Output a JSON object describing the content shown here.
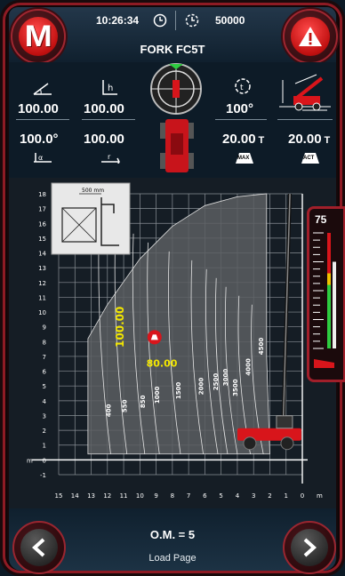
{
  "header": {
    "time": "10:26:34",
    "hours": "50000",
    "model": "FORK FC5T"
  },
  "params": {
    "row1_left_a": "100.00",
    "row1_left_b": "100.00",
    "row1_right": "100",
    "row1_right_unit": "°",
    "row2_left_a": "100.0°",
    "row2_left_b": "100.00",
    "row2_right_a": "20.00",
    "row2_right_a_unit": "T",
    "row2_right_b": "20.00",
    "row2_right_b_unit": "T",
    "max_label": "MAX",
    "act_label": "ACT"
  },
  "chart": {
    "inset_label": "500 mm",
    "boom_angle_value": "100.00",
    "load_value": "80.00",
    "y_unit": "m",
    "x_unit": "m",
    "y_ticks": [
      "18",
      "17",
      "16",
      "15",
      "14",
      "13",
      "12",
      "11",
      "10",
      "9",
      "8",
      "7",
      "6",
      "5",
      "4",
      "3",
      "2",
      "1",
      "0",
      "-1"
    ],
    "x_ticks": [
      "15",
      "14",
      "13",
      "12",
      "11",
      "10",
      "9",
      "8",
      "7",
      "6",
      "5",
      "4",
      "3",
      "2",
      "1",
      "0"
    ],
    "curve_labels": [
      "400",
      "550",
      "850",
      "1000",
      "1500",
      "2000",
      "2500",
      "3000",
      "3500",
      "4000",
      "4500"
    ]
  },
  "gauge": {
    "percent": "75",
    "level": 0.75
  },
  "footer": {
    "om_text": "O.M. = 5",
    "page_label": "Load Page"
  },
  "colors": {
    "accent_red": "#d8151b",
    "value_yellow": "#f2e600",
    "gauge_green": "#2ecc40"
  }
}
